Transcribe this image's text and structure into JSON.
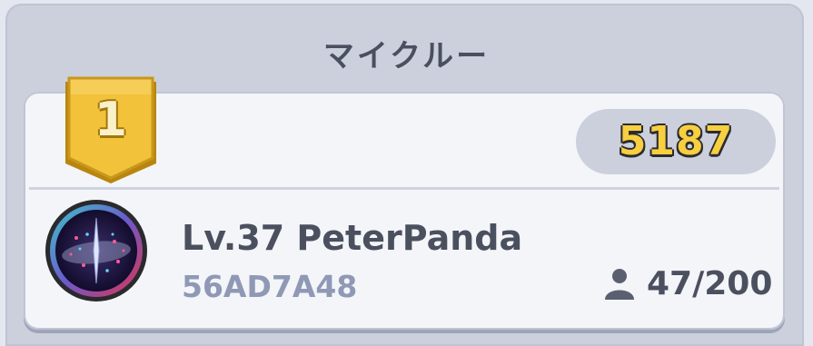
{
  "panel": {
    "title": "マイクルー"
  },
  "crew": {
    "rank": "1",
    "score": "5187",
    "player_name": "Lv.37 PeterPanda",
    "player_id": "56AD7A48",
    "member_count": "47/200"
  },
  "icons": {
    "rank_badge": "gold-shield-icon",
    "member": "person-icon",
    "avatar": "crew-emblem-avatar"
  },
  "colors": {
    "badge_gold": "#f2c23a",
    "score_yellow": "#f7cf3f",
    "id_blue": "#8f99b6",
    "name_gray": "#4b505f"
  }
}
